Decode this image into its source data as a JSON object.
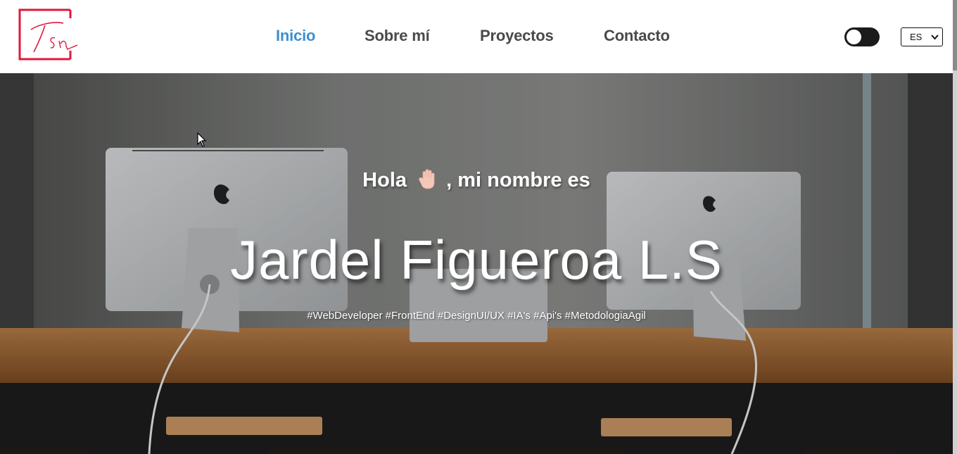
{
  "header": {
    "logo_text": "Tsn",
    "nav": [
      {
        "label": "Inicio",
        "active": true
      },
      {
        "label": "Sobre mí",
        "active": false
      },
      {
        "label": "Proyectos",
        "active": false
      },
      {
        "label": "Contacto",
        "active": false
      }
    ],
    "theme_toggle": {
      "state": "off"
    },
    "language": {
      "selected": "ES"
    }
  },
  "hero": {
    "greeting_before": "Hola",
    "greeting_emoji": "raised-hand-icon",
    "greeting_after": ", mi nombre es",
    "name": "Jardel Figueroa L.S",
    "tagline": "#WebDeveloper #FrontEnd #DesignUI/UX #IA's #Api's #MetodologiaAgil"
  },
  "colors": {
    "accent": "#3d8fd1",
    "logo": "#e0183c",
    "nav_text": "#4a4a4a"
  }
}
